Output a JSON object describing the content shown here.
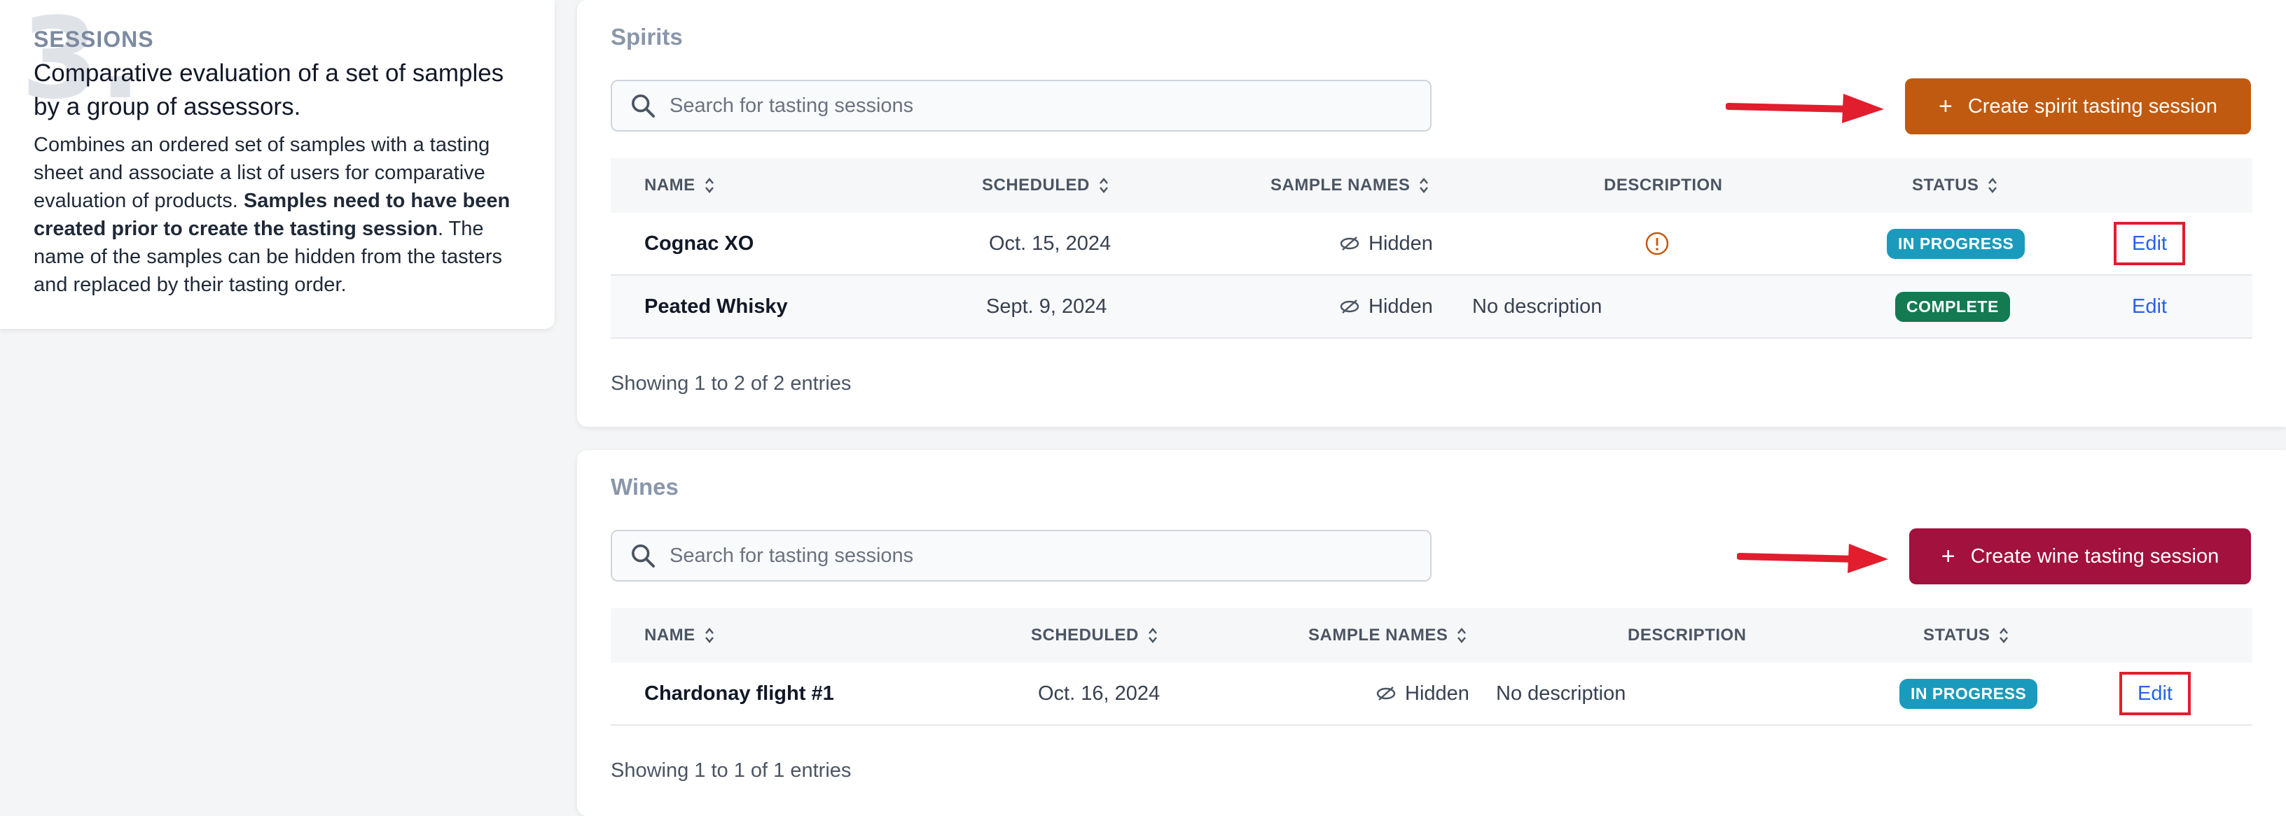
{
  "info": {
    "big_number": "3.",
    "kicker": "SESSIONS",
    "lead": "Comparative evaluation of a set of samples by a group of assessors.",
    "body_start": "Combines an ordered set of samples with a tasting sheet and associate a list of users for comparative evaluation of products. ",
    "body_bold": "Samples need to have been created prior to create the tasting session",
    "body_end": ". The name of the samples can be hidden from the tasters and replaced by their tasting order."
  },
  "spirits": {
    "title": "Spirits",
    "search_placeholder": "Search for tasting sessions",
    "create_label": "Create spirit tasting session",
    "create_plus": "+",
    "columns": [
      "NAME",
      "SCHEDULED",
      "SAMPLE NAMES",
      "DESCRIPTION",
      "STATUS"
    ],
    "rows": [
      {
        "name": "Cognac XO",
        "scheduled": "Oct. 15, 2024",
        "sample_names": "Hidden",
        "description_icon": "info-circle-icon",
        "status": "IN PROGRESS",
        "action": "Edit"
      },
      {
        "name": "Peated Whisky",
        "scheduled": "Sept. 9, 2024",
        "sample_names": "Hidden",
        "description": "No description",
        "status": "COMPLETE",
        "action": "Edit"
      }
    ],
    "entries": "Showing 1 to 2 of 2 entries"
  },
  "wines": {
    "title": "Wines",
    "search_placeholder": "Search for tasting sessions",
    "create_label": "Create wine tasting session",
    "create_plus": "+",
    "columns": [
      "NAME",
      "SCHEDULED",
      "SAMPLE NAMES",
      "DESCRIPTION",
      "STATUS"
    ],
    "rows": [
      {
        "name": "Chardonay flight #1",
        "scheduled": "Oct. 16, 2024",
        "sample_names": "Hidden",
        "description": "No description",
        "status": "IN PROGRESS",
        "action": "Edit"
      }
    ],
    "entries": "Showing 1 to 1 of 1 entries"
  },
  "colors": {
    "spirit_button": "#c05a10",
    "wine_button": "#a3113e",
    "in_progress": "#1a9bbd",
    "complete": "#137a52",
    "annotation_red": "#e11d2e",
    "link_blue": "#2563eb"
  }
}
